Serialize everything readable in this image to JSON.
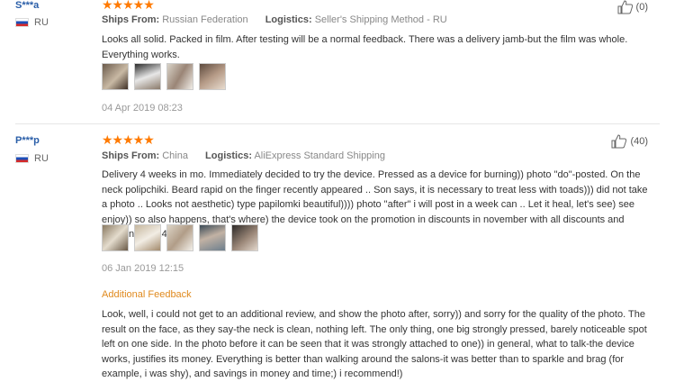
{
  "reviews": [
    {
      "author": "S***a",
      "country": "RU",
      "stars": "★★★★★",
      "ships_label": "Ships From:",
      "ships_value": "Russian Federation",
      "logistics_label": "Logistics:",
      "logistics_value": "Seller's Shipping Method - RU",
      "text": "Looks all solid. Packed in film. After testing will be a normal feedback. There was a delivery jamb-but the film was whole. Everything works.",
      "date": "04 Apr 2019 08:23",
      "helpful": "(0)"
    },
    {
      "author": "P***p",
      "country": "RU",
      "stars": "★★★★★",
      "ships_label": "Ships From:",
      "ships_value": "China",
      "logistics_label": "Logistics:",
      "logistics_value": "AliExpress Standard Shipping",
      "text": "Delivery 4 weeks in mo. Immediately decided to try the device. Pressed as a device for burning)) photo \"do\"-posted. On the neck polipchiki. Beard rapid on the finger recently appeared .. Son says, it is necessary to treat less with toads))) did not take a photo .. Looks not aesthetic) type papilomki beautiful)))) photo \"after\" i will post in a week can .. Let it heal, let's see) see enjoy)) so also happens, that's where) the device took on the promotion in discounts in november with all discounts and coupons for 1415₽.",
      "date": "06 Jan 2019 12:15",
      "helpful": "(40)",
      "additional_title": "Additional Feedback",
      "additional_text": "Look, well, i could not get to an additional review, and show the photo after, sorry)) and sorry for the quality of the photo. The result on the face, as they say-the neck is clean, nothing left. The only thing, one big strongly pressed, barely noticeable spot left on one side. In the photo before it can be seen that it was strongly attached to one)) in general, what to talk-the device works, justifies its money. Everything is better than walking around the salons-it was better than to sparkle and brag (for example, i was shy), and savings in money and time;) i recommend!)"
    }
  ],
  "colors": {
    "star": "#ff7a00",
    "author": "#2a5ea8",
    "additional": "#e08a1e"
  }
}
